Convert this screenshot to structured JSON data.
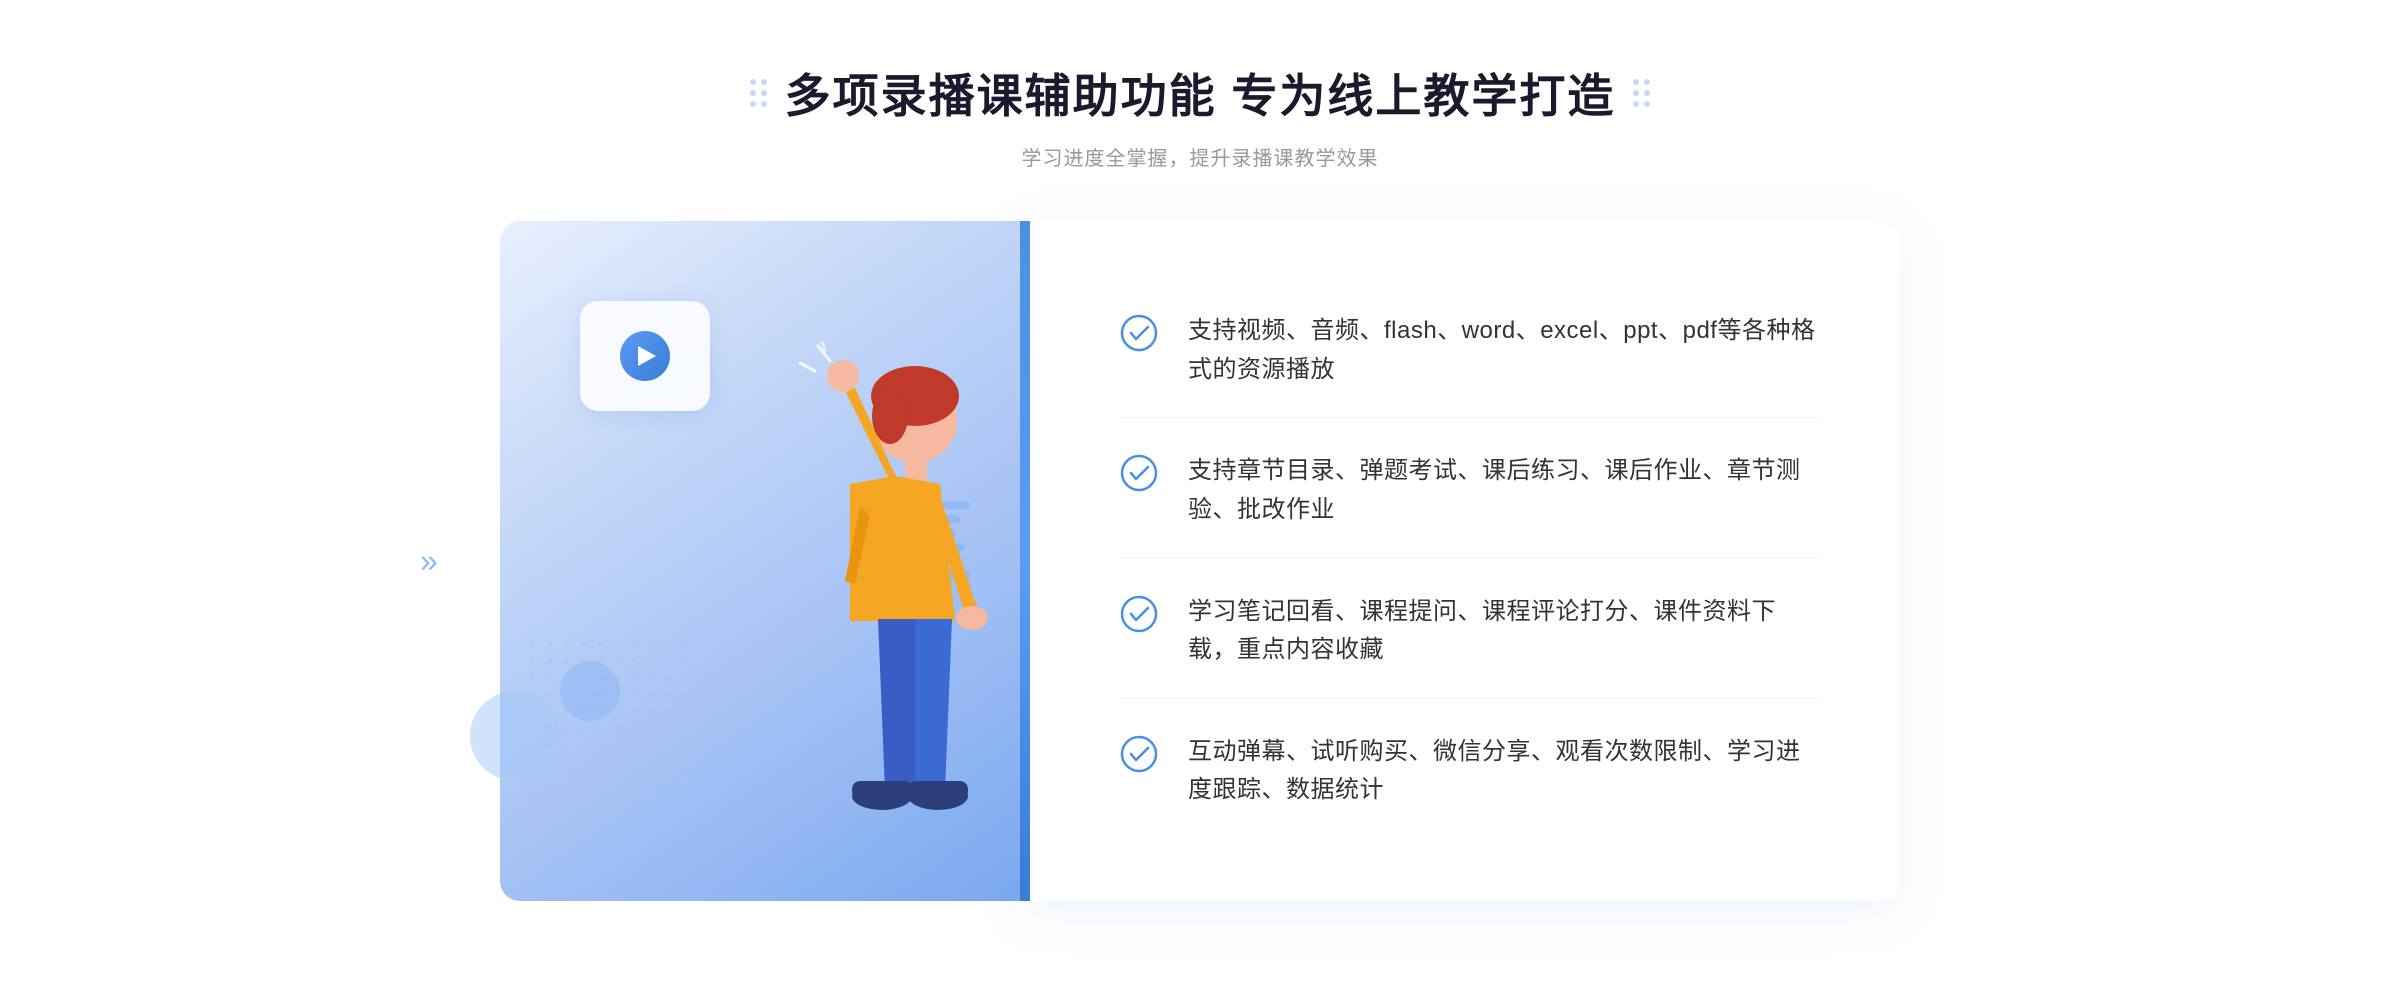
{
  "page": {
    "title": "多项录播课辅助功能 专为线上教学打造",
    "subtitle": "学习进度全掌握，提升录播课教学效果"
  },
  "features": [
    {
      "id": "feature-1",
      "text": "支持视频、音频、flash、word、excel、ppt、pdf等各种格式的资源播放"
    },
    {
      "id": "feature-2",
      "text": "支持章节目录、弹题考试、课后练习、课后作业、章节测验、批改作业"
    },
    {
      "id": "feature-3",
      "text": "学习笔记回看、课程提问、课程评论打分、课件资料下载，重点内容收藏"
    },
    {
      "id": "feature-4",
      "text": "互动弹幕、试听购买、微信分享、观看次数限制、学习进度跟踪、数据统计"
    }
  ],
  "decorations": {
    "arrow_left": "»",
    "dots_left": "⠿",
    "decoration_dots_top_left": "⋮⋮",
    "decoration_dots_top_right": "⋮⋮"
  }
}
